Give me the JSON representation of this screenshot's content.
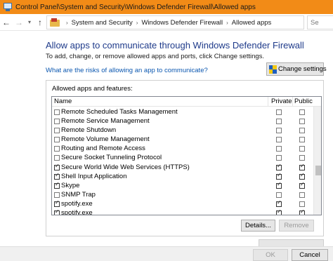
{
  "window": {
    "title": "Control Panel\\System and Security\\Windows Defender Firewall\\Allowed apps",
    "titlebar_color": "#f28b17"
  },
  "addressbar": {
    "back_icon": "arrow-left-icon",
    "forward_icon": "arrow-right-icon",
    "recent_icon": "chevron-down-icon",
    "up_icon": "arrow-up-icon",
    "breadcrumb": [
      "System and Security",
      "Windows Defender Firewall",
      "Allowed apps"
    ],
    "search_text": "Se"
  },
  "main": {
    "heading": "Allow apps to communicate through Windows Defender Firewall",
    "description": "To add, change, or remove allowed apps and ports, click Change settings.",
    "risk_link": "What are the risks of allowing an app to communicate?",
    "change_settings_label": "Change settings",
    "heading_color": "#1e3a8a",
    "link_color": "#0b57b0"
  },
  "apps": {
    "group_label": "Allowed apps and features:",
    "columns": {
      "name": "Name",
      "private": "Private",
      "public": "Public"
    },
    "rows": [
      {
        "name": "Remote Scheduled Tasks Management",
        "enabled": false,
        "private": false,
        "public": false
      },
      {
        "name": "Remote Service Management",
        "enabled": false,
        "private": false,
        "public": false
      },
      {
        "name": "Remote Shutdown",
        "enabled": false,
        "private": false,
        "public": false
      },
      {
        "name": "Remote Volume Management",
        "enabled": false,
        "private": false,
        "public": false
      },
      {
        "name": "Routing and Remote Access",
        "enabled": false,
        "private": false,
        "public": false
      },
      {
        "name": "Secure Socket Tunneling Protocol",
        "enabled": false,
        "private": false,
        "public": false
      },
      {
        "name": "Secure World Wide Web Services (HTTPS)",
        "enabled": true,
        "private": true,
        "public": true
      },
      {
        "name": "Shell Input Application",
        "enabled": true,
        "private": true,
        "public": true
      },
      {
        "name": "Skype",
        "enabled": true,
        "private": true,
        "public": true
      },
      {
        "name": "SNMP Trap",
        "enabled": false,
        "private": false,
        "public": false
      },
      {
        "name": "spotify.exe",
        "enabled": true,
        "private": true,
        "public": false
      },
      {
        "name": "spotify.exe",
        "enabled": true,
        "private": true,
        "public": true
      }
    ],
    "details_label": "Details...",
    "remove_label": "Remove"
  },
  "footer": {
    "ok_label": "OK",
    "cancel_label": "Cancel"
  }
}
